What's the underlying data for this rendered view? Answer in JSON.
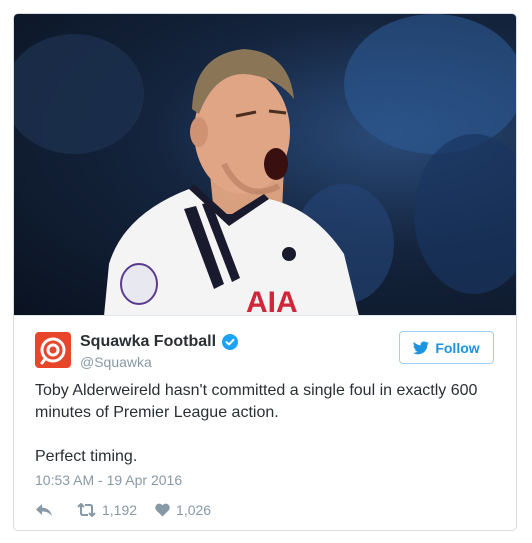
{
  "author": {
    "name": "Squawka Football",
    "handle": "@Squawka",
    "verified": true,
    "avatar_icon": "squawka-logo-icon",
    "avatar_color": "#e8462b"
  },
  "follow_button": {
    "label": "Follow",
    "icon": "twitter-bird-icon",
    "color": "#1b95e0"
  },
  "media": {
    "photo_icon": "player-photo-icon",
    "jersey_text": "AIA"
  },
  "tweet": {
    "lines": [
      "Toby Alderweireld hasn't committed a single foul in exactly 600 minutes of Premier League action.",
      "Perfect timing."
    ],
    "timestamp": "10:53 AM - 19 Apr 2016"
  },
  "actions": {
    "reply_icon": "reply-icon",
    "retweet_icon": "retweet-icon",
    "retweets": "1,192",
    "like_icon": "heart-icon",
    "likes": "1,026"
  },
  "colors": {
    "muted": "#8899a6",
    "text": "#292f33",
    "border": "#d8dde1"
  }
}
